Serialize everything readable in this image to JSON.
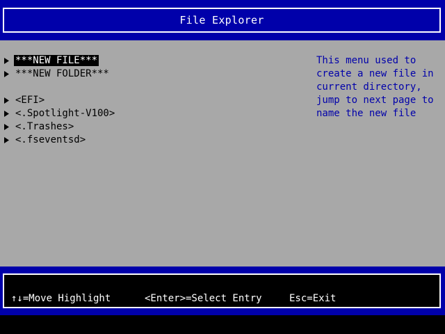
{
  "header": {
    "title": "File Explorer"
  },
  "entries": [
    {
      "label": "***NEW FILE***",
      "selected": true
    },
    {
      "label": "***NEW FOLDER***",
      "selected": false
    },
    {
      "label": "<EFI>",
      "selected": false
    },
    {
      "label": "<.Spotlight-V100>",
      "selected": false
    },
    {
      "label": "<.Trashes>",
      "selected": false
    },
    {
      "label": "<.fseventsd>",
      "selected": false
    }
  ],
  "help": {
    "lines": [
      "This menu used to",
      "create a new file in",
      "current directory,",
      "jump to next page to",
      "name the new file"
    ]
  },
  "footer": {
    "move_hint": "↑↓=Move Highlight",
    "enter_hint": "<Enter>=Select Entry",
    "esc_hint": "Esc=Exit"
  },
  "colors": {
    "band": "#0000aa",
    "panel": "#a8a8a8",
    "help_text": "#0000aa",
    "highlight_bg": "#000000",
    "highlight_fg": "#ffffff"
  }
}
